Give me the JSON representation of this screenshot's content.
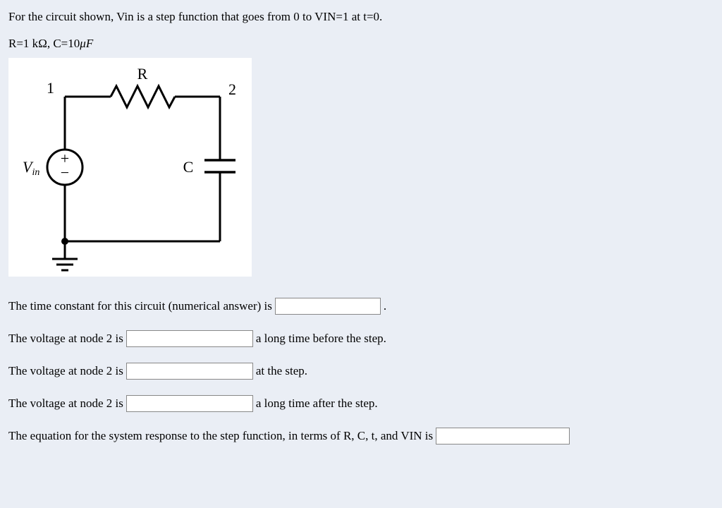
{
  "problem": {
    "intro": "For the circuit shown, Vin is a step function that goes from 0 to VIN=1 at t=0.",
    "params_prefix": "R=1 k",
    "params_mid": ", C=10",
    "ohm": "Ω",
    "mu": "μ",
    "F": "F"
  },
  "circuit": {
    "R": "R",
    "C": "C",
    "node1": "1",
    "node2": "2",
    "Vin": "V",
    "Vin_sub": "in",
    "plus": "+",
    "minus": "−"
  },
  "questions": {
    "q1_pre": "The time constant for this circuit (numerical answer) is",
    "q1_post": ".",
    "q2_pre": "The voltage at node 2 is",
    "q2_post": "a long time before the step.",
    "q3_pre": "The voltage at node 2 is",
    "q3_post": "at the step.",
    "q4_pre": "The voltage at node 2 is",
    "q4_post": "a long time after the step.",
    "q5_pre": "The equation for the system response to the step function, in terms of R, C, t, and VIN is"
  }
}
